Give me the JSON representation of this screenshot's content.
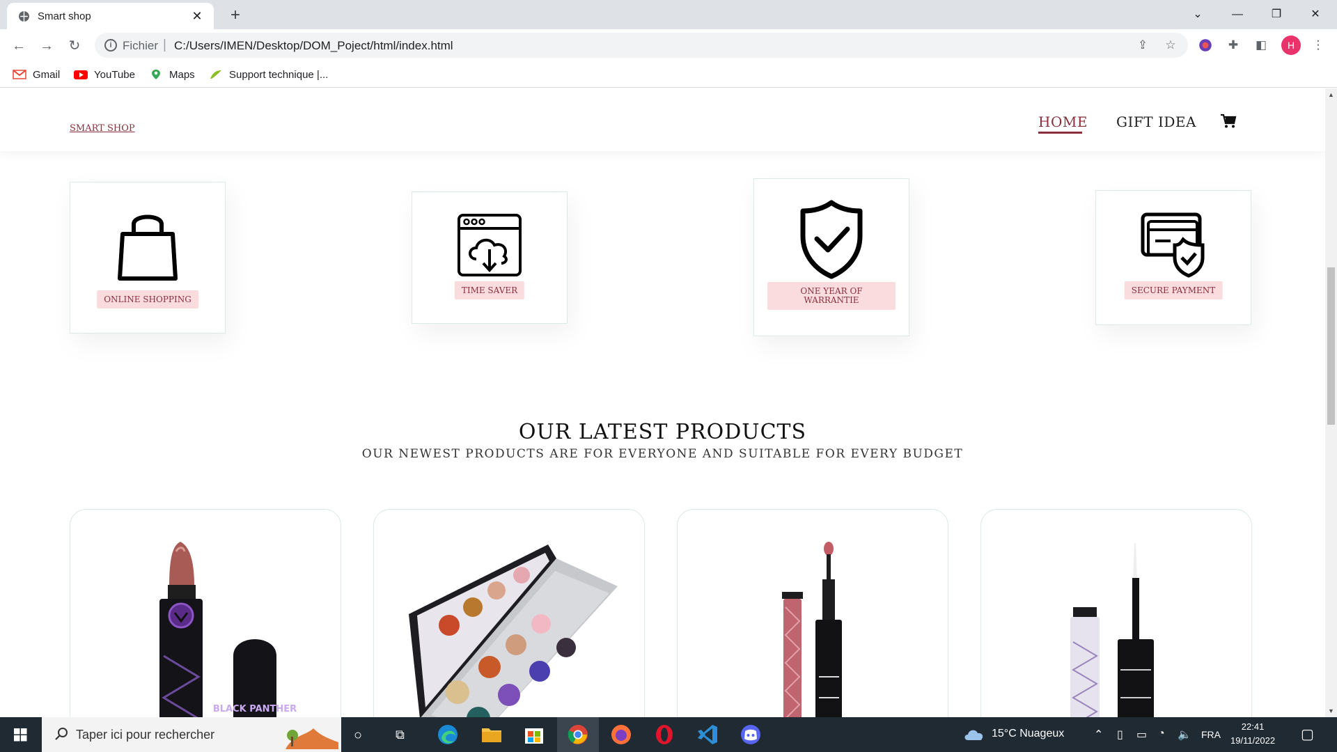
{
  "browser": {
    "tab_title": "Smart shop",
    "url_scheme": "Fichier",
    "url": "C:/Users/IMEN/Desktop/DOM_Poject/html/index.html",
    "profile_initial": "H",
    "bookmarks": [
      {
        "label": "Gmail",
        "icon": "gmail-icon"
      },
      {
        "label": "YouTube",
        "icon": "youtube-icon"
      },
      {
        "label": "Maps",
        "icon": "maps-icon"
      },
      {
        "label": "Support technique |...",
        "icon": "support-icon"
      }
    ]
  },
  "site": {
    "brand": "SMART SHOP",
    "nav": {
      "home": "HOME",
      "gift": "GIFT IDEA"
    },
    "features": [
      {
        "label": "ONLINE SHOPPING",
        "icon": "shopping-bag-icon"
      },
      {
        "label": "TIME SAVER",
        "icon": "cloud-download-icon"
      },
      {
        "label": "ONE YEAR OF WARRANTIE",
        "icon": "shield-check-icon"
      },
      {
        "label": "SECURE PAYMENT",
        "icon": "secure-card-icon"
      }
    ],
    "latest": {
      "title": "OUR LATEST PRODUCTS",
      "subtitle": "OUR NEWEST PRODUCTS ARE FOR EVERYONE AND SUITABLE FOR EVERY BUDGET"
    },
    "products": [
      {
        "name": "lipstick",
        "packaging_text": "BLACK PANTHER"
      },
      {
        "name": "eyeshadow-palette"
      },
      {
        "name": "lip-gloss"
      },
      {
        "name": "eyeliner"
      }
    ]
  },
  "taskbar": {
    "search_placeholder": "Taper ici pour rechercher",
    "weather": "15°C  Nuageux",
    "language": "FRA",
    "time": "22:41",
    "date": "19/11/2022"
  },
  "colors": {
    "accent": "#8b2e3c",
    "label_bg": "#fadcdf",
    "border": "#dce9e6"
  }
}
